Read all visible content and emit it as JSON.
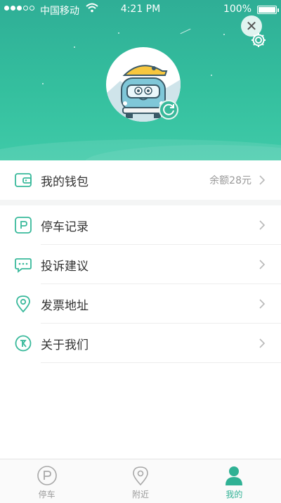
{
  "status_bar": {
    "carrier": "中国移动",
    "time": "4:21 PM",
    "battery": "100%"
  },
  "header": {
    "close_icon": "close-icon",
    "settings_icon": "gear-icon"
  },
  "wallet": {
    "label": "我的钱包",
    "balance": "余额28元",
    "icon": "wallet-icon"
  },
  "menu": [
    {
      "label": "停车记录",
      "icon": "parking-icon"
    },
    {
      "label": "投诉建议",
      "icon": "chat-icon"
    },
    {
      "label": "发票地址",
      "icon": "location-icon"
    },
    {
      "label": "关于我们",
      "icon": "logo-icon"
    }
  ],
  "tabbar": [
    {
      "label": "停车",
      "icon": "parking-tab-icon"
    },
    {
      "label": "附近",
      "icon": "location-tab-icon"
    },
    {
      "label": "我的",
      "icon": "person-icon",
      "active": true
    }
  ],
  "colors": {
    "accent": "#2fb194",
    "header_top": "#2fae96",
    "header_bottom": "#3fcaa8"
  }
}
